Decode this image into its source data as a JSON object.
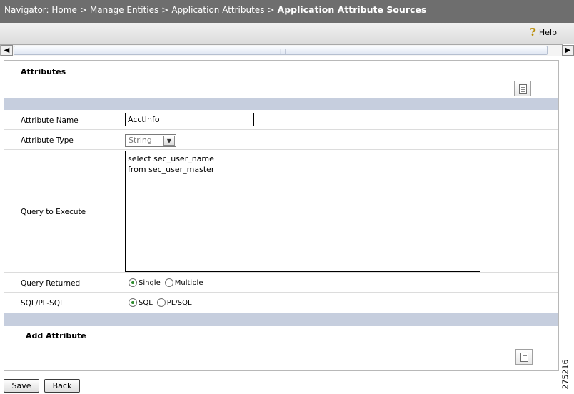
{
  "navigator": {
    "prefix": "Navigator:",
    "links": [
      "Home",
      "Manage Entities",
      "Application Attributes"
    ],
    "separator": ">",
    "current": "Application Attribute Sources"
  },
  "help": {
    "label": "Help",
    "icon": "help-question-icon"
  },
  "scrollbar": {
    "left_icon": "scroll-left-arrow-icon",
    "right_icon": "scroll-right-arrow-icon"
  },
  "attributes_section": {
    "title": "Attributes",
    "button_icon": "report-document-icon"
  },
  "form": {
    "attribute_name": {
      "label": "Attribute Name",
      "value": "AcctInfo"
    },
    "attribute_type": {
      "label": "Attribute Type",
      "value": "String"
    },
    "query": {
      "label": "Query to Execute",
      "value": "select sec_user_name\nfrom sec_user_master"
    },
    "query_returned": {
      "label": "Query Returned",
      "options": [
        "Single",
        "Multiple"
      ],
      "selected": "Single"
    },
    "sql_type": {
      "label": "SQL/PL-SQL",
      "options": [
        "SQL",
        "PL/SQL"
      ],
      "selected": "SQL"
    }
  },
  "add_section": {
    "title": "Add Attribute",
    "button_icon": "report-document-icon"
  },
  "buttons": {
    "save": "Save",
    "back": "Back"
  },
  "figure_number": "275216",
  "colors": {
    "navbar": "#6e6e6e",
    "band": "#c6cede",
    "radio_checked": "#2d8b2d"
  }
}
